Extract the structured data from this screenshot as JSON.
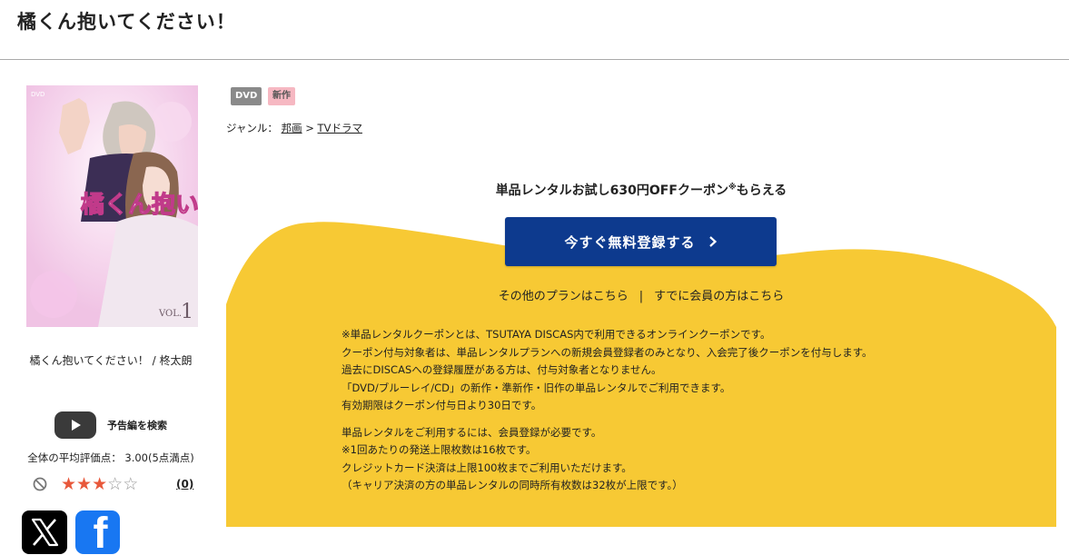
{
  "page": {
    "title": "橘くん抱いてください！"
  },
  "cover": {
    "title_art_text": "橘くん抱いてください！",
    "volume_text": "VOL.",
    "volume_number": "1",
    "format_mark": "DVD",
    "caption": "橘くん抱いてください！ / 柊太朗"
  },
  "trailer": {
    "label": "予告編を検索",
    "icon": "youtube-play-icon"
  },
  "rating": {
    "summary": "全体の平均評価点： 3.00(5点満点)",
    "stars_filled": 3,
    "stars_total": 5,
    "review_count": "(0)"
  },
  "social": {
    "x_icon": "x-logo-icon",
    "facebook_icon": "facebook-logo-icon",
    "facebook_glyph": "f"
  },
  "badges": {
    "format": "DVD",
    "new": "新作"
  },
  "genre": {
    "label": "ジャンル：",
    "items": [
      "邦画",
      "TVドラマ"
    ],
    "separator": ">"
  },
  "promo": {
    "offer_text": "単品レンタルお試し630円OFFクーポン",
    "offer_mark": "※",
    "offer_suffix": "もらえる",
    "signup_label": "今すぐ無料登録する",
    "other_plans_link": "その他のプランはこちら",
    "link_separator": "|",
    "member_link": "すでに会員の方はこちら",
    "notes_block1": [
      "※単品レンタルクーポンとは、TSUTAYA DISCAS内で利用できるオンラインクーポンです。",
      "クーポン付与対象者は、単品レンタルプランへの新規会員登録者のみとなり、入会完了後クーポンを付与します。",
      "過去にDISCASへの登録履歴がある方は、付与対象者となりません。",
      "「DVD/ブルーレイ/CD」の新作・準新作・旧作の単品レンタルでご利用できます。",
      "有効期限はクーポン付与日より30日です。"
    ],
    "notes_block2": [
      "単品レンタルをご利用するには、会員登録が必要です。",
      "※1回あたりの発送上限枚数は16枚です。",
      "クレジットカード決済は上限100枚までご利用いただけます。",
      "（キャリア決済の方の単品レンタルの同時所有枚数は32枚が上限です。）"
    ]
  },
  "colors": {
    "accent_yellow": "#f7c934",
    "button_navy": "#0d3a8e",
    "star_red": "#e8583b",
    "badge_gray": "#8a8a8a",
    "badge_pink": "#f6b8c2"
  }
}
